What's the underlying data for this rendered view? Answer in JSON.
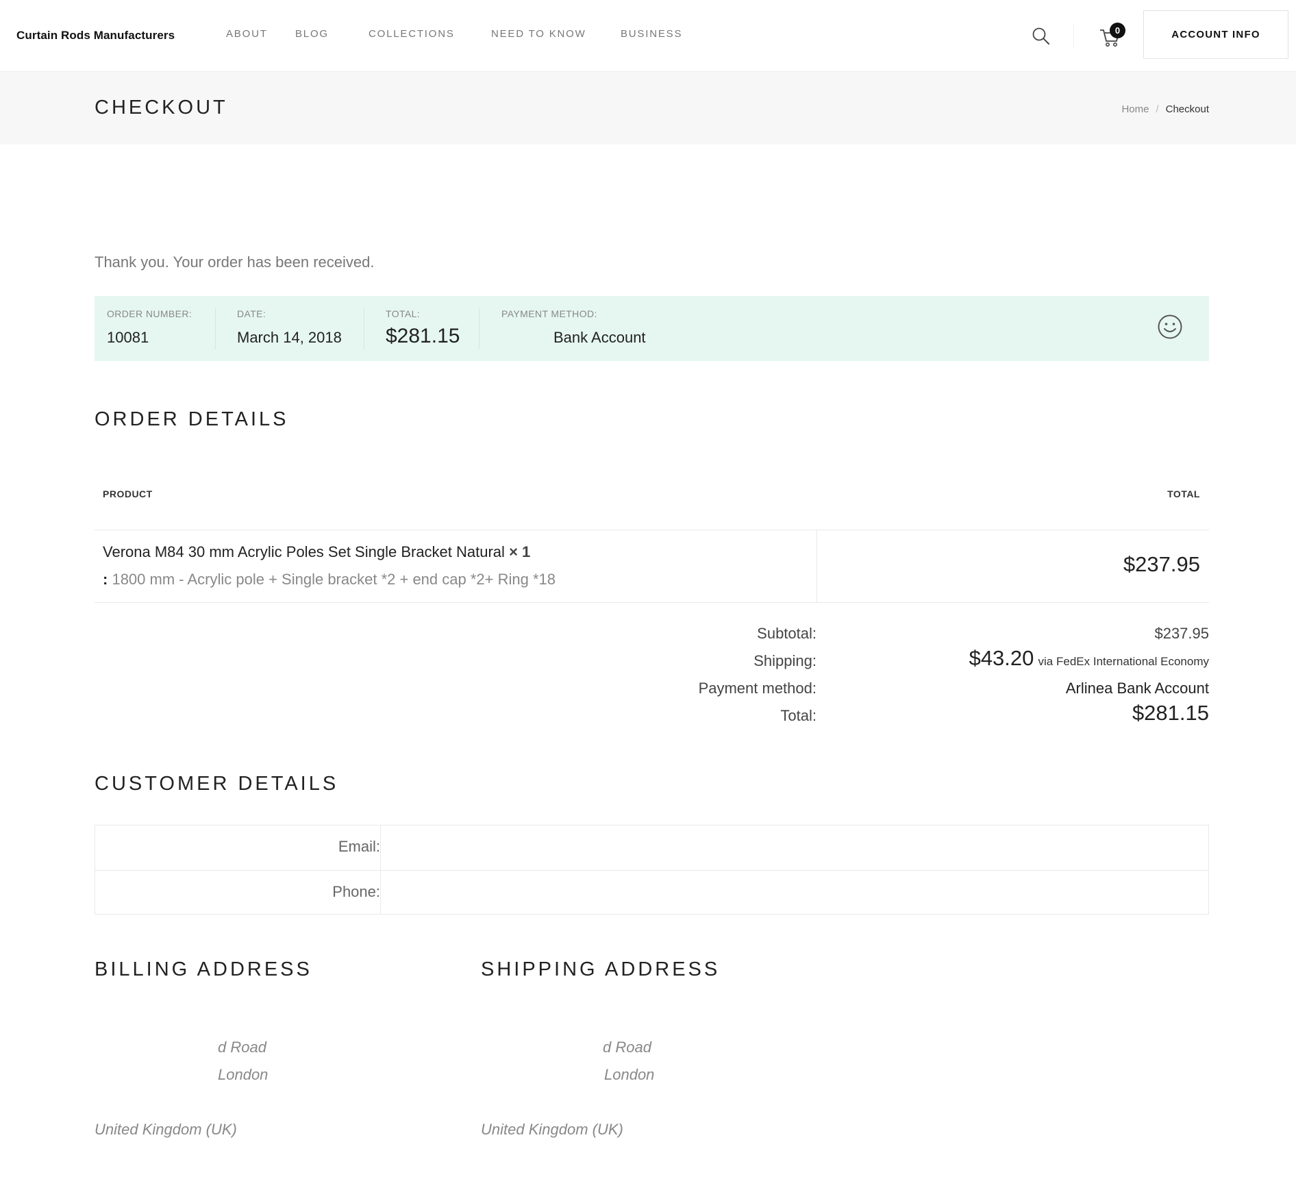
{
  "header": {
    "logo": "Curtain Rods Manufacturers",
    "nav": [
      "ABOUT",
      "BLOG",
      "COLLECTIONS",
      "NEED TO KNOW",
      "BUSINESS"
    ],
    "cart_count": "0",
    "account_label": "ACCOUNT INFO"
  },
  "title_band": {
    "title": "CHECKOUT",
    "breadcrumb": {
      "home": "Home",
      "separator": "/",
      "current": "Checkout"
    }
  },
  "thanks": "Thank you. Your order has been received.",
  "overview": {
    "order_number_label": "ORDER NUMBER:",
    "order_number": "10081",
    "date_label": "DATE:",
    "date": "March 14, 2018",
    "total_label": "TOTAL:",
    "total": "$281.15",
    "payment_label": "PAYMENT METHOD:",
    "payment": "Bank Account",
    "accent_color": "#e6f7f1"
  },
  "order_details": {
    "heading": "ORDER DETAILS",
    "col_product": "PRODUCT",
    "col_total": "TOTAL",
    "item": {
      "name": "Verona M84 30 mm Acrylic Poles Set Single Bracket Natural",
      "qty": "× 1",
      "meta_prefix": ":",
      "meta": "1800 mm - Acrylic pole + Single bracket *2 + end cap *2+ Ring *18",
      "total": "$237.95"
    },
    "summary": {
      "subtotal_label": "Subtotal:",
      "subtotal": "$237.95",
      "shipping_label": "Shipping:",
      "shipping_amount": "$43.20",
      "shipping_via": "via FedEx International Economy",
      "payment_label": "Payment method:",
      "payment": "Arlinea Bank Account",
      "total_label": "Total:",
      "total": "$281.15"
    }
  },
  "customer_details": {
    "heading": "CUSTOMER DETAILS",
    "email_label": "Email:",
    "email": "",
    "phone_label": "Phone:",
    "phone": ""
  },
  "billing": {
    "heading": "BILLING ADDRESS",
    "line1": "d Road",
    "line2": "London",
    "country": "United Kingdom (UK)"
  },
  "shipping": {
    "heading": "SHIPPING ADDRESS",
    "line1": "d Road",
    "line2": "London",
    "country": "United Kingdom (UK)"
  }
}
